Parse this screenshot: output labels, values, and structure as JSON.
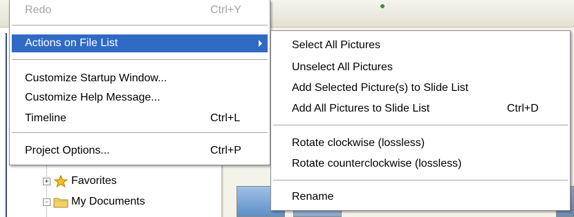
{
  "main_menu": {
    "items": [
      {
        "label": "Redo",
        "shortcut": "Ctrl+Y"
      },
      {
        "label": "Actions on File List"
      },
      {
        "label": "Customize Startup Window..."
      },
      {
        "label": "Customize Help Message..."
      },
      {
        "label": "Timeline",
        "shortcut": "Ctrl+L"
      },
      {
        "label": "Project Options...",
        "shortcut": "Ctrl+P"
      }
    ]
  },
  "sub_menu": {
    "items": [
      {
        "label": "Select All Pictures"
      },
      {
        "label": "Unselect All Pictures"
      },
      {
        "label": "Add Selected Picture(s) to Slide List"
      },
      {
        "label": "Add All Pictures to Slide List",
        "shortcut": "Ctrl+D"
      },
      {
        "label": "Rotate clockwise (lossless)"
      },
      {
        "label": "Rotate counterclockwise (lossless)"
      },
      {
        "label": "Rename"
      }
    ]
  },
  "tree": {
    "items": [
      {
        "label": "Favorites",
        "expander": "+",
        "icon": "star-folder-icon"
      },
      {
        "label": "My Documents",
        "expander": "-",
        "icon": "folder-icon"
      }
    ]
  },
  "colors": {
    "highlight": "#316ac5",
    "disabled_text": "#a3a3a3"
  }
}
